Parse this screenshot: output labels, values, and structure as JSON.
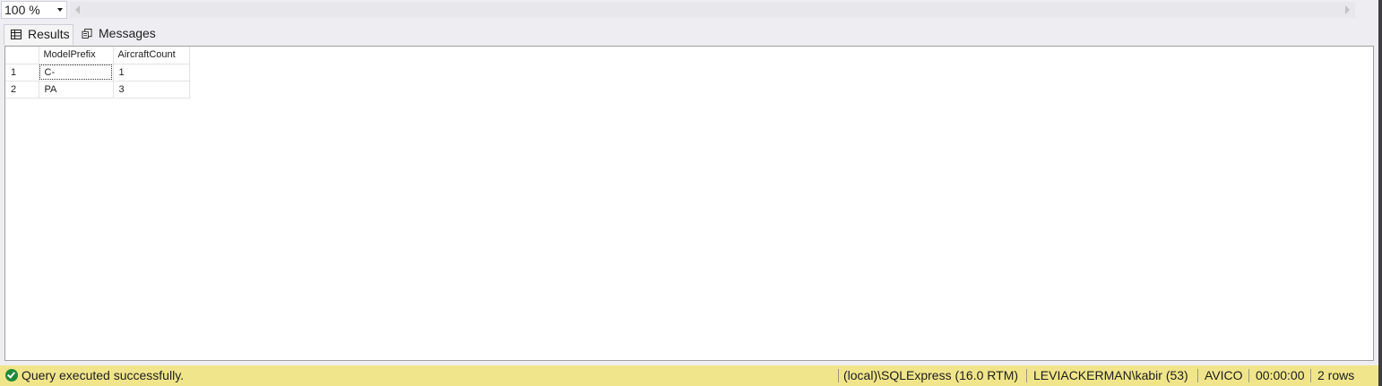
{
  "zoom": {
    "value": "100 %"
  },
  "tabs": [
    {
      "label": "Results",
      "icon": "grid-icon"
    },
    {
      "label": "Messages",
      "icon": "messages-icon"
    }
  ],
  "grid": {
    "columns": [
      "ModelPrefix",
      "AircraftCount"
    ],
    "rows": [
      {
        "num": "1",
        "cells": [
          "C-",
          "1"
        ]
      },
      {
        "num": "2",
        "cells": [
          "PA",
          "3"
        ]
      }
    ]
  },
  "status": {
    "message": "Query executed successfully.",
    "server": "(local)\\SQLExpress (16.0 RTM)",
    "user": "LEVIACKERMAN\\kabir (53)",
    "database": "AVICO",
    "elapsed": "00:00:00",
    "rows": "2 rows",
    "color": "#f1e58b"
  }
}
